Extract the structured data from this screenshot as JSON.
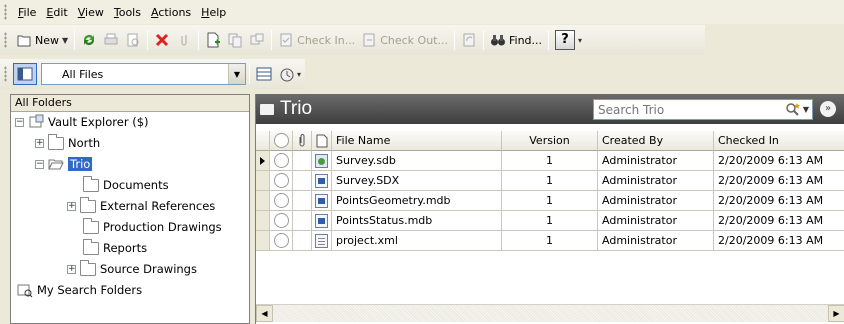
{
  "menu": [
    {
      "key": "F",
      "rest": "ile"
    },
    {
      "key": "E",
      "rest": "dit"
    },
    {
      "key": "V",
      "rest": "iew"
    },
    {
      "key": "T",
      "rest": "ools"
    },
    {
      "key": "A",
      "rest": "ctions"
    },
    {
      "key": "H",
      "rest": "elp"
    }
  ],
  "toolbar": {
    "new_label": "New",
    "check_in_label": "Check In...",
    "check_out_label": "Check Out...",
    "find_label": "Find...",
    "help_label": "?"
  },
  "view": {
    "selected": "All Files"
  },
  "tree": {
    "header": "All Folders",
    "root": "Vault Explorer ($)",
    "items": [
      "North",
      "Trio",
      "Documents",
      "External References",
      "Production Drawings",
      "Reports",
      "Source Drawings"
    ],
    "search_folders": "My Search Folders"
  },
  "folder": {
    "title": "Trio",
    "search_placeholder": "Search Trio"
  },
  "grid": {
    "columns": [
      "File Name",
      "Version",
      "Created By",
      "Checked In"
    ],
    "rows": [
      {
        "name": "Survey.sdb",
        "version": "1",
        "created_by": "Administrator",
        "checked_in": "2/20/2009 6:13 AM",
        "icon": "sdb-file-icon"
      },
      {
        "name": "Survey.SDX",
        "version": "1",
        "created_by": "Administrator",
        "checked_in": "2/20/2009 6:13 AM",
        "icon": "sdx-file-icon"
      },
      {
        "name": "PointsGeometry.mdb",
        "version": "1",
        "created_by": "Administrator",
        "checked_in": "2/20/2009 6:13 AM",
        "icon": "mdb-file-icon"
      },
      {
        "name": "PointsStatus.mdb",
        "version": "1",
        "created_by": "Administrator",
        "checked_in": "2/20/2009 6:13 AM",
        "icon": "mdb-file-icon"
      },
      {
        "name": "project.xml",
        "version": "1",
        "created_by": "Administrator",
        "checked_in": "2/20/2009 6:13 AM",
        "icon": "xml-file-icon"
      }
    ]
  },
  "colors": {
    "selection": "#316ac5",
    "header_dark": "#4a4a4a",
    "chrome": "#ece9d8"
  }
}
